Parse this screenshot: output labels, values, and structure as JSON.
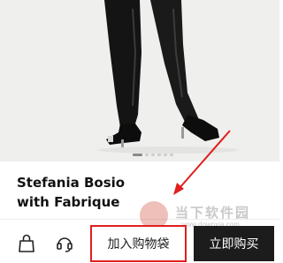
{
  "product": {
    "image": "product-photo",
    "title_line1": "Stefania Bosio",
    "title_line2": "with Fabrique",
    "carousel": {
      "count": 6,
      "active": 1
    }
  },
  "actions": {
    "bag_icon": "shopping-bag-icon",
    "support_icon": "headset-icon",
    "add_to_cart_label": "加入购物袋",
    "buy_now_label": "立即购买"
  },
  "watermark": {
    "brand_cn": "当下软件园",
    "url": "www.downxia.com"
  },
  "colors": {
    "highlight": "#e01f1f",
    "buy_button": "#1c1c1c"
  }
}
